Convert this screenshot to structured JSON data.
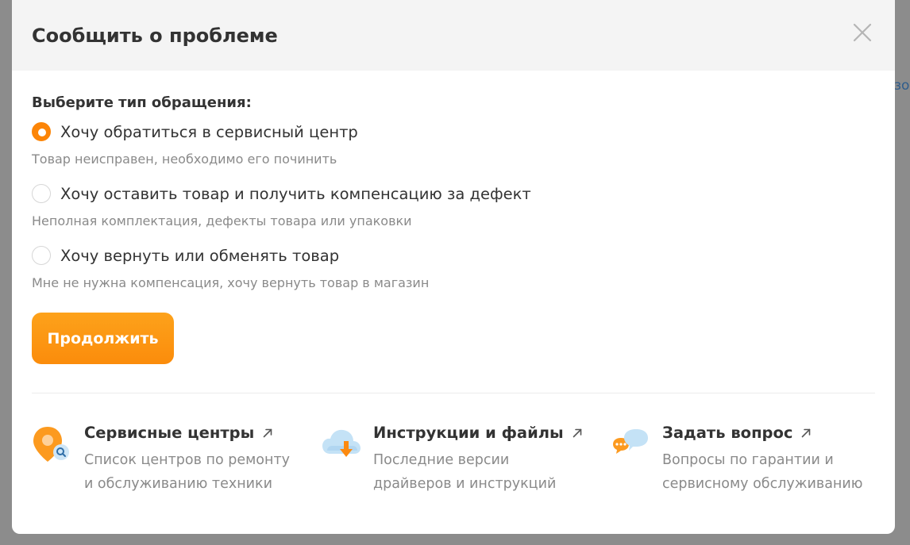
{
  "backdrop": {
    "peek_text": "зо"
  },
  "modal": {
    "title": "Сообщить о проблеме",
    "close_label": "×"
  },
  "form": {
    "section_label": "Выберите тип обращения:",
    "options": [
      {
        "label": "Хочу обратиться в сервисный центр",
        "description": "Товар неисправен, необходимо его починить",
        "checked": true
      },
      {
        "label": "Хочу оставить товар и получить компенсацию за дефект",
        "description": "Неполная комплектация, дефекты товара или упаковки",
        "checked": false
      },
      {
        "label": "Хочу вернуть или обменять товар",
        "description": "Мне не нужна компенсация, хочу вернуть товар в магазин",
        "checked": false
      }
    ],
    "continue_label": "Продолжить"
  },
  "links": [
    {
      "title": "Сервисные центры",
      "description_line1": "Список центров по ремонту",
      "description_line2": "и обслуживанию техники",
      "icon": "service-center-pin-icon"
    },
    {
      "title": "Инструкции и файлы",
      "description_line1": "Последние версии",
      "description_line2": "драйверов и инструкций",
      "icon": "cloud-download-icon"
    },
    {
      "title": "Задать вопрос",
      "description_line1": "Вопросы по гарантии и",
      "description_line2": "сервисному обслуживанию",
      "icon": "chat-bubbles-icon"
    }
  ],
  "colors": {
    "accent": "#fc8507",
    "accent_light": "#fda21b",
    "title_text": "#333333",
    "muted_text": "#8a8a8a",
    "header_bg": "#f4f4f4",
    "icon_blue": "#b8dcf3"
  }
}
